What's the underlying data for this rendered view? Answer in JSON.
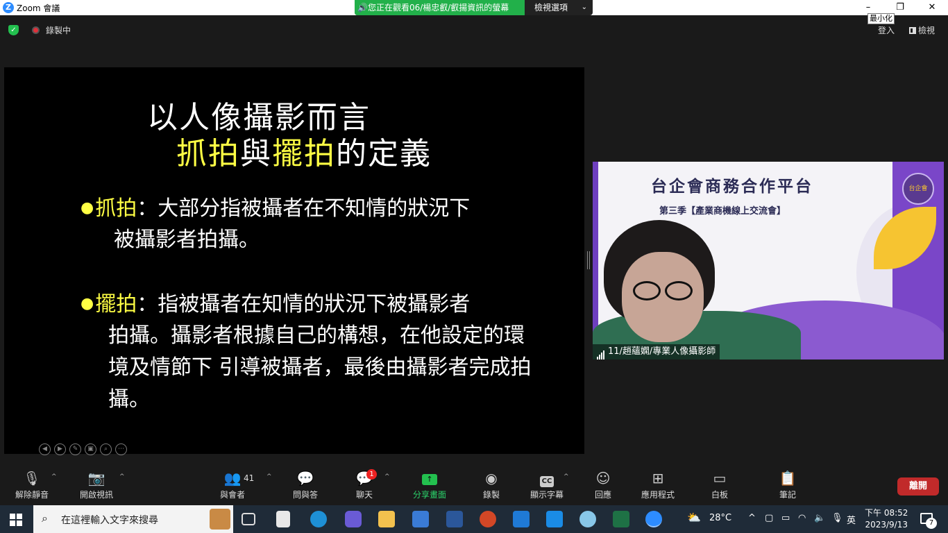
{
  "window": {
    "title": "Zoom 會議",
    "app_icon": "zoom-icon",
    "viewing_banner": "🔊您正在觀看06/楊忠叡/叡揚資訊的螢幕",
    "view_options_label": "檢視選項",
    "minimize_tooltip": "最小化"
  },
  "topbar": {
    "recording_label": "錄製中",
    "login_label": "登入",
    "view_label": "檢視"
  },
  "slide": {
    "title_line1": "以人像攝影而言",
    "title_line2_part1": "抓拍",
    "title_line2_part2": "與",
    "title_line2_part3": "擺拍",
    "title_line2_part4": "的定義",
    "bullet1_term": "抓拍",
    "bullet1_text": "：大部分指被攝者在不知情的狀況下",
    "bullet1_cont": "被攝影者拍攝。",
    "bullet2_term": "擺拍",
    "bullet2_text": "：指被攝者在知情的狀況下被攝影者",
    "bullet2_cont": "拍攝。攝影者根據自己的構想，在他設定的環境及情節下 引導被攝者，最後由攝影者完成拍攝。"
  },
  "video": {
    "banner_title": "台企會商務合作平台",
    "banner_subtitle": "第三季【產業商機線上交流會】",
    "logo_text": "台企會",
    "participant_name": "11/趙蘊嫻/專業人像攝影師"
  },
  "toolbar": {
    "unmute": "解除靜音",
    "start_video": "開啟視訊",
    "participants": "與會者",
    "participants_count": "41",
    "qa": "問與答",
    "chat": "聊天",
    "chat_badge": "1",
    "share": "分享畫面",
    "record": "錄製",
    "captions": "顯示字幕",
    "captions_icon": "CC",
    "reactions": "回應",
    "apps": "應用程式",
    "whiteboard": "白板",
    "notes": "筆記",
    "leave": "離開"
  },
  "taskbar": {
    "search_placeholder": "在這裡輸入文字來搜尋",
    "weather": "28°C",
    "ime": "英",
    "time": "下午 08:52",
    "date": "2023/9/13",
    "notifications": "7"
  },
  "colors": {
    "accent_green": "#23c04f",
    "leave_red": "#c12a2a",
    "highlight_yellow": "#ffff44"
  }
}
